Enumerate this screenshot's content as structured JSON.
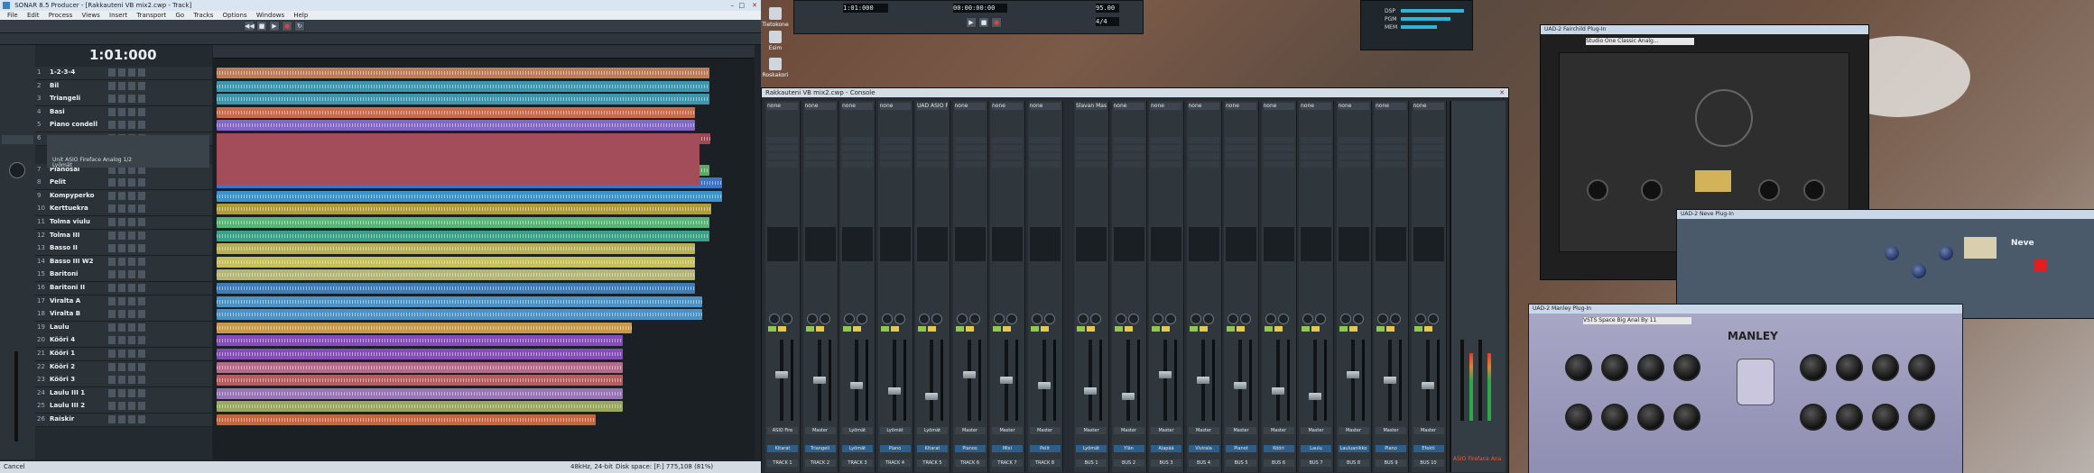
{
  "sonar": {
    "title": "SONAR 8.5 Producer - [Rakkauteni VB mix2.cwp - Track]",
    "menus": [
      "File",
      "Edit",
      "Process",
      "Views",
      "Insert",
      "Transport",
      "Go",
      "Tracks",
      "Options",
      "Windows",
      "Help"
    ],
    "time_display": "1:01:000",
    "tracks": [
      {
        "num": "1",
        "name": "1-2-3-4"
      },
      {
        "num": "2",
        "name": "Bil"
      },
      {
        "num": "3",
        "name": "Triangeli"
      },
      {
        "num": "4",
        "name": "Basi"
      },
      {
        "num": "5",
        "name": "Piano condell"
      },
      {
        "num": "6",
        "name": ""
      },
      {
        "num": "7",
        "name": "Pianosal"
      },
      {
        "num": "8",
        "name": "Pelit"
      },
      {
        "num": "9",
        "name": "Kompyperko"
      },
      {
        "num": "10",
        "name": "Kerttuekra"
      },
      {
        "num": "11",
        "name": "Tolma viulu"
      },
      {
        "num": "12",
        "name": "Tolma III"
      },
      {
        "num": "13",
        "name": "Basso II"
      },
      {
        "num": "14",
        "name": "Basso III W2"
      },
      {
        "num": "15",
        "name": "Baritoni"
      },
      {
        "num": "16",
        "name": "Baritoni II"
      },
      {
        "num": "17",
        "name": "Viralta A"
      },
      {
        "num": "18",
        "name": "Viralta B"
      },
      {
        "num": "19",
        "name": "Laulu"
      },
      {
        "num": "20",
        "name": "Kööri 4"
      },
      {
        "num": "21",
        "name": "Kööri 1"
      },
      {
        "num": "22",
        "name": "Kööri 2"
      },
      {
        "num": "23",
        "name": "Kööri 3"
      },
      {
        "num": "24",
        "name": "Laulu III 1"
      },
      {
        "num": "25",
        "name": "Laulu III 2"
      },
      {
        "num": "26",
        "name": "Raiskir"
      }
    ],
    "track_detail": {
      "line1": "Unit ASIO Fireface Analog 1/2",
      "line2": "Lyömät"
    },
    "statusbar": {
      "left": "Cancel",
      "sample_rate": "48kHz, 24-bit",
      "disk": "Disk space: [F:] 775,108 (81%)"
    }
  },
  "desktop_icons": [
    {
      "label": "Tietokone"
    },
    {
      "label": "Esim"
    },
    {
      "label": "Roskakori"
    }
  ],
  "transport": {
    "time1": "1:01:000",
    "time2": "00:00:00:00",
    "tempo": "95.00",
    "meter": "4/4"
  },
  "vu_meters": {
    "labels": [
      "DSP",
      "PGM",
      "MEM"
    ]
  },
  "console": {
    "title": "Rakkauteni VB mix2.cwp - Console",
    "strips": [
      {
        "name": "none",
        "out": "ASIO Fire",
        "label": "Kitarat",
        "bus": "TRACK 1"
      },
      {
        "name": "none",
        "out": "Master",
        "label": "Triangeli",
        "bus": "TRACK 2"
      },
      {
        "name": "none",
        "out": "Lyömät",
        "label": "Lyömät",
        "bus": "TRACK 3"
      },
      {
        "name": "none",
        "out": "Lyömät",
        "label": "Piano",
        "bus": "TRACK 4"
      },
      {
        "name": "UAD ASIO Fir",
        "out": "Lyömät",
        "label": "Kitarat",
        "bus": "TRACK 5"
      },
      {
        "name": "none",
        "out": "Master",
        "label": "Pianos",
        "bus": "TRACK 6"
      },
      {
        "name": "none",
        "out": "Master",
        "label": "Mixi",
        "bus": "TRACK 7"
      },
      {
        "name": "none",
        "out": "Master",
        "label": "Pelit",
        "bus": "TRACK 8"
      },
      {
        "name": "Slavan Master",
        "out": "Master",
        "label": "Lyömät",
        "bus": "BUS 1"
      },
      {
        "name": "none",
        "out": "Master",
        "label": "Ylän",
        "bus": "BUS 2"
      },
      {
        "name": "none",
        "out": "Master",
        "label": "Alapää",
        "bus": "BUS 3"
      },
      {
        "name": "none",
        "out": "Master",
        "label": "Vivirala",
        "bus": "BUS 4"
      },
      {
        "name": "none",
        "out": "Master",
        "label": "Pianot",
        "bus": "BUS 5"
      },
      {
        "name": "none",
        "out": "Master",
        "label": "Kööri",
        "bus": "BUS 6"
      },
      {
        "name": "none",
        "out": "Master",
        "label": "Laulu",
        "bus": "BUS 7"
      },
      {
        "name": "none",
        "out": "Master",
        "label": "Lauluanikko",
        "bus": "BUS 8"
      },
      {
        "name": "none",
        "out": "Master",
        "label": "Piano",
        "bus": "BUS 9"
      },
      {
        "name": "none",
        "out": "Master",
        "label": "Efekti",
        "bus": "BUS 10"
      }
    ],
    "master_label": "ASIO Fireface Ana"
  },
  "plugins": {
    "comp_title": "UAD-2 Fairchild Plug-In",
    "comp_preset": "Studio One Classic Analg...",
    "neve_title": "UAD-2 Neve Plug-In",
    "manley_title": "UAD-2 Manley Plug-In",
    "manley_preset": "VSTS Space Big Anal By 11",
    "manley_brand": "MANLEY",
    "neve_brand": "Neve"
  },
  "colors": {
    "clip_colors": [
      "#c4845c",
      "#3e9db5",
      "#3e9db5",
      "#d5704c",
      "#8a6ad0",
      "#a34c5a",
      "#5fb36a",
      "#3d7ad0",
      "#3c9ad3",
      "#b9a43a",
      "#5abf7a",
      "#3aa88c",
      "#c0b85a",
      "#cfc95a",
      "#bcbf7a",
      "#3e82c0",
      "#4e9ad0",
      "#4e9ad0",
      "#d1a04a",
      "#8a50c0",
      "#8a50c0",
      "#c07090",
      "#c06060",
      "#a07ac0",
      "#a0b060",
      "#d06a40"
    ]
  }
}
